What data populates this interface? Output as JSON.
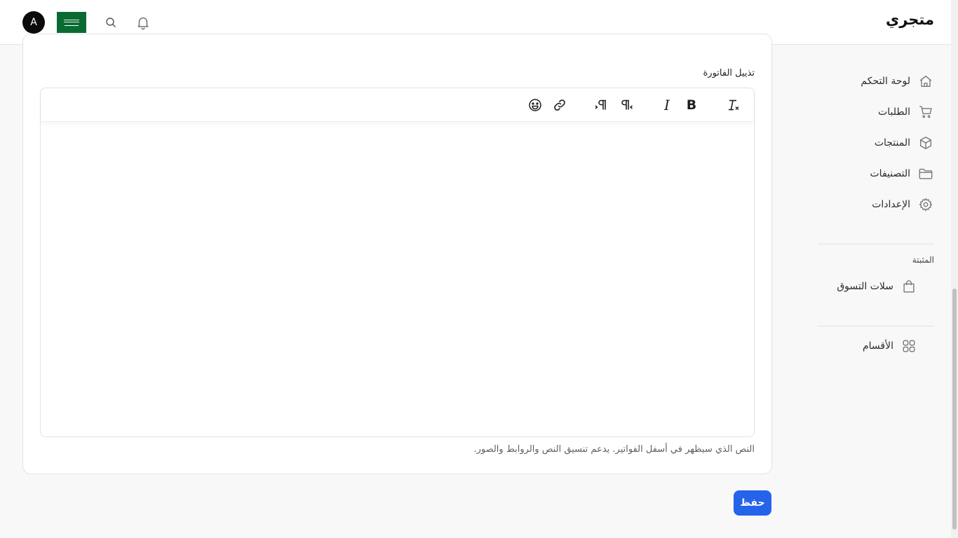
{
  "header": {
    "brand": "متجري",
    "avatar_initial": "A",
    "icons": [
      "bell-icon",
      "search-icon",
      "saudi-flag-icon"
    ]
  },
  "sidebar": {
    "items": [
      {
        "label": "لوحة التحكم",
        "icon": "home-icon"
      },
      {
        "label": "الطلبات",
        "icon": "cart-icon"
      },
      {
        "label": "المنتجات",
        "icon": "box-icon"
      },
      {
        "label": "التصنيفات",
        "icon": "folder-icon"
      },
      {
        "label": "الإعدادات",
        "icon": "gear-icon"
      }
    ],
    "pinned_section_label": "المثبتة",
    "pinned_items": [
      {
        "label": "سلات التسوق",
        "icon": "shopping-bag-icon"
      }
    ],
    "bottom_items": [
      {
        "label": "الأقسام",
        "icon": "grid-icon"
      }
    ]
  },
  "form": {
    "field_label": "تذييل الفاتورة",
    "helper_text": "النص الذي سيظهر في أسفل الفواتير. يدعم تنسيق النص والروابط والصور.",
    "editor_value": "",
    "toolbar": {
      "bold": "B",
      "italic": "I",
      "tools": [
        "clear-format-icon",
        "bold-icon",
        "italic-icon",
        "rtl-paragraph-icon",
        "ltr-paragraph-icon",
        "link-icon",
        "emoji-icon"
      ]
    }
  },
  "actions": {
    "save_label": "حفظ"
  },
  "colors": {
    "primary": "#2563eb",
    "flag_green": "#0a6b32"
  }
}
